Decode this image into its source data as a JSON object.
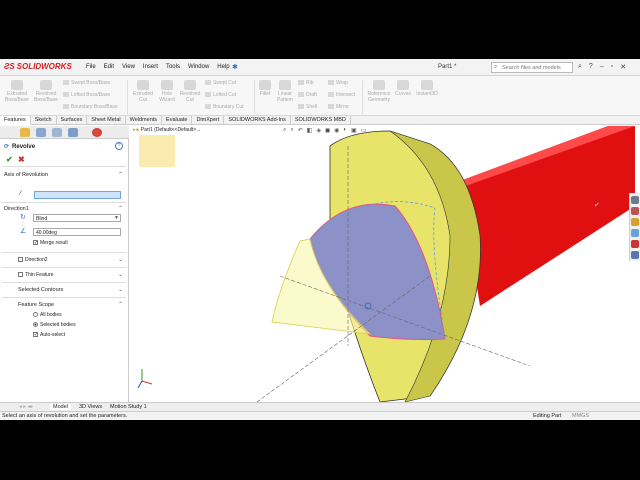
{
  "app": {
    "logo_text": "SOLIDWORKS",
    "menu": [
      "File",
      "Edit",
      "View",
      "Insert",
      "Tools",
      "Window",
      "Help"
    ],
    "document_title": "Part1 *",
    "search_placeholder": "Search files and models"
  },
  "ribbon": {
    "large_buttons": [
      {
        "label": "Extruded Boss/Base",
        "icon": "extrude-boss-icon"
      },
      {
        "label": "Revolved Boss/Base",
        "icon": "revolve-boss-icon"
      },
      {
        "label": "Extruded Cut",
        "icon": "extrude-cut-icon"
      },
      {
        "label": "Hole Wizard",
        "icon": "hole-wizard-icon"
      },
      {
        "label": "Revolved Cut",
        "icon": "revolve-cut-icon"
      },
      {
        "label": "Fillet",
        "icon": "fillet-icon"
      },
      {
        "label": "Linear Pattern",
        "icon": "linear-pattern-icon"
      },
      {
        "label": "Reference Geometry",
        "icon": "reference-geometry-icon"
      },
      {
        "label": "Curves",
        "icon": "curves-icon"
      },
      {
        "label": "Instant3D",
        "icon": "instant3d-icon"
      }
    ],
    "small_buttons": [
      "Swept Boss/Base",
      "Lofted Boss/Base",
      "Boundary Boss/Base",
      "Swept Cut",
      "Lofted Cut",
      "Boundary Cut",
      "Rib",
      "Draft",
      "Shell",
      "Wrap",
      "Intersect",
      "Mirror"
    ]
  },
  "command_tabs": [
    "Features",
    "Sketch",
    "Surfaces",
    "Sheet Metal",
    "Weldments",
    "Evaluate",
    "DimXpert",
    "SOLIDWORKS Add-Ins",
    "SOLIDWORKS MBD"
  ],
  "active_command_tab": "Features",
  "property_manager": {
    "title": "Revolve",
    "axis_section": "Axis of Revolution",
    "direction1_section": "Direction1",
    "end_condition": "Blind",
    "angle": "40.00deg",
    "merge_result": "Merge result",
    "direction2_section": "Direction2",
    "thin_feature_section": "Thin Feature",
    "selected_contours_section": "Selected Contours",
    "feature_scope_section": "Feature Scope",
    "scope_options": [
      "All bodies",
      "Selected bodies"
    ],
    "auto_select": "Auto-select"
  },
  "tree": {
    "part_label": "Part1",
    "config_label": "(Default<<Default>..."
  },
  "bottom_tabs": [
    "Model",
    "3D Views",
    "Motion Study 1"
  ],
  "active_bottom_tab": "Model",
  "status": {
    "message": "Select an axis of revolution and set the parameters.",
    "mode": "Editing Part",
    "units": "MMGS"
  },
  "colors": {
    "solid_yellow": "#e8e46a",
    "shaft_red": "#e01010",
    "preview_blue": "#8c92c8",
    "selection_pink": "#e8508a"
  }
}
